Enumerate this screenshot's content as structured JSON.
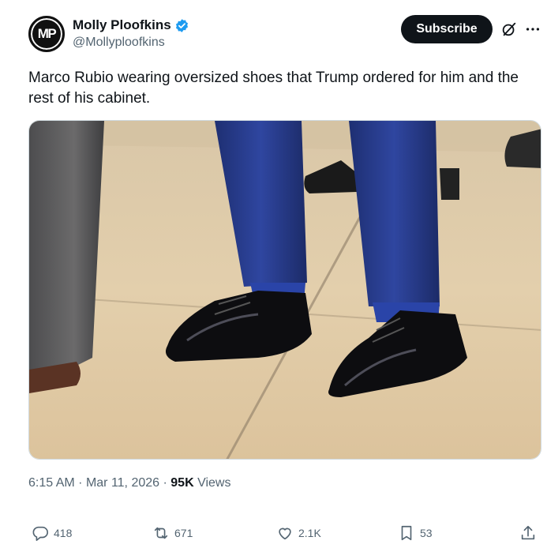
{
  "author": {
    "avatar_text": "MP",
    "display_name": "Molly Ploofkins",
    "handle": "@Mollyploofkins"
  },
  "header": {
    "subscribe_label": "Subscribe",
    "more_label": "···"
  },
  "tweet": {
    "text": "Marco Rubio wearing oversized shoes that Trump ordered for him and the rest of his cabinet."
  },
  "meta": {
    "time": "6:15 AM",
    "separator": "·",
    "date": "Mar 11, 2026",
    "views_count": "95K",
    "views_label": "Views"
  },
  "actions": {
    "replies": "418",
    "reposts": "671",
    "likes": "2.1K",
    "bookmarks": "53"
  },
  "colors": {
    "accent": "#1d9bf0",
    "text_primary": "#0f1419",
    "text_secondary": "#536471",
    "button_bg": "#0f1419"
  },
  "icons": [
    "verified-badge-icon",
    "grok-icon",
    "more-icon",
    "reply-icon",
    "repost-icon",
    "like-icon",
    "bookmark-icon",
    "share-icon"
  ]
}
